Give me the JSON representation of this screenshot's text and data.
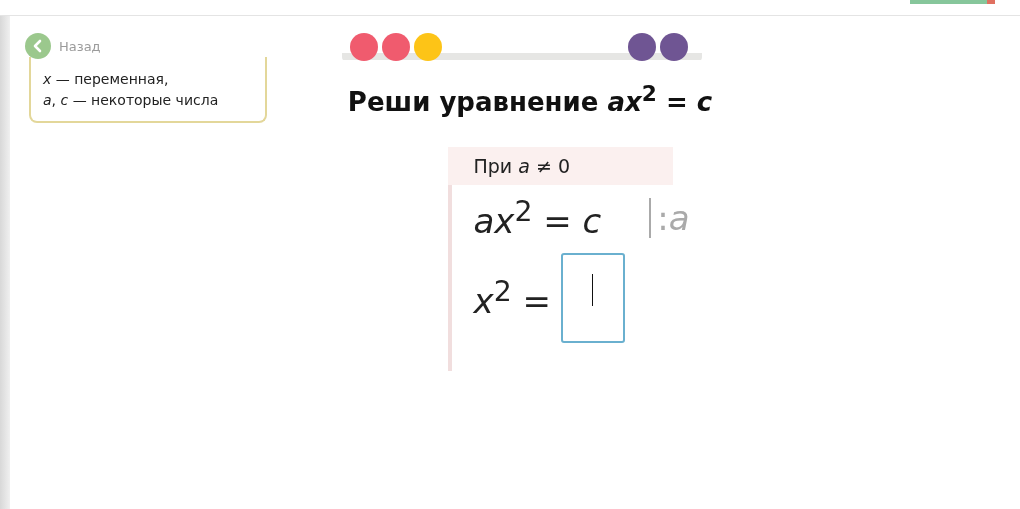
{
  "top_progress": {
    "level": 0.9
  },
  "back": {
    "label": "Назад"
  },
  "hint": {
    "lines": [
      "*x* — переменная,",
      "*a*, *c* — некоторые числа"
    ]
  },
  "progress": {
    "done": [
      {
        "color": "#f05b6e"
      },
      {
        "color": "#f05b6e"
      },
      {
        "color": "#fdc417"
      }
    ],
    "remaining": [
      {
        "color": "#6f5593"
      },
      {
        "color": "#6f5593"
      }
    ]
  },
  "title": "Реши уравнение *ax*$^{2}$ = *c*",
  "solution": {
    "condition": "При *a* ≠ 0",
    "steps": [
      {
        "kind": "equation",
        "text": "*ax*$^{2}$ = *c*",
        "operation": ":*a*"
      },
      {
        "kind": "answer",
        "text": "*x*$^{2}$ ="
      }
    ]
  }
}
